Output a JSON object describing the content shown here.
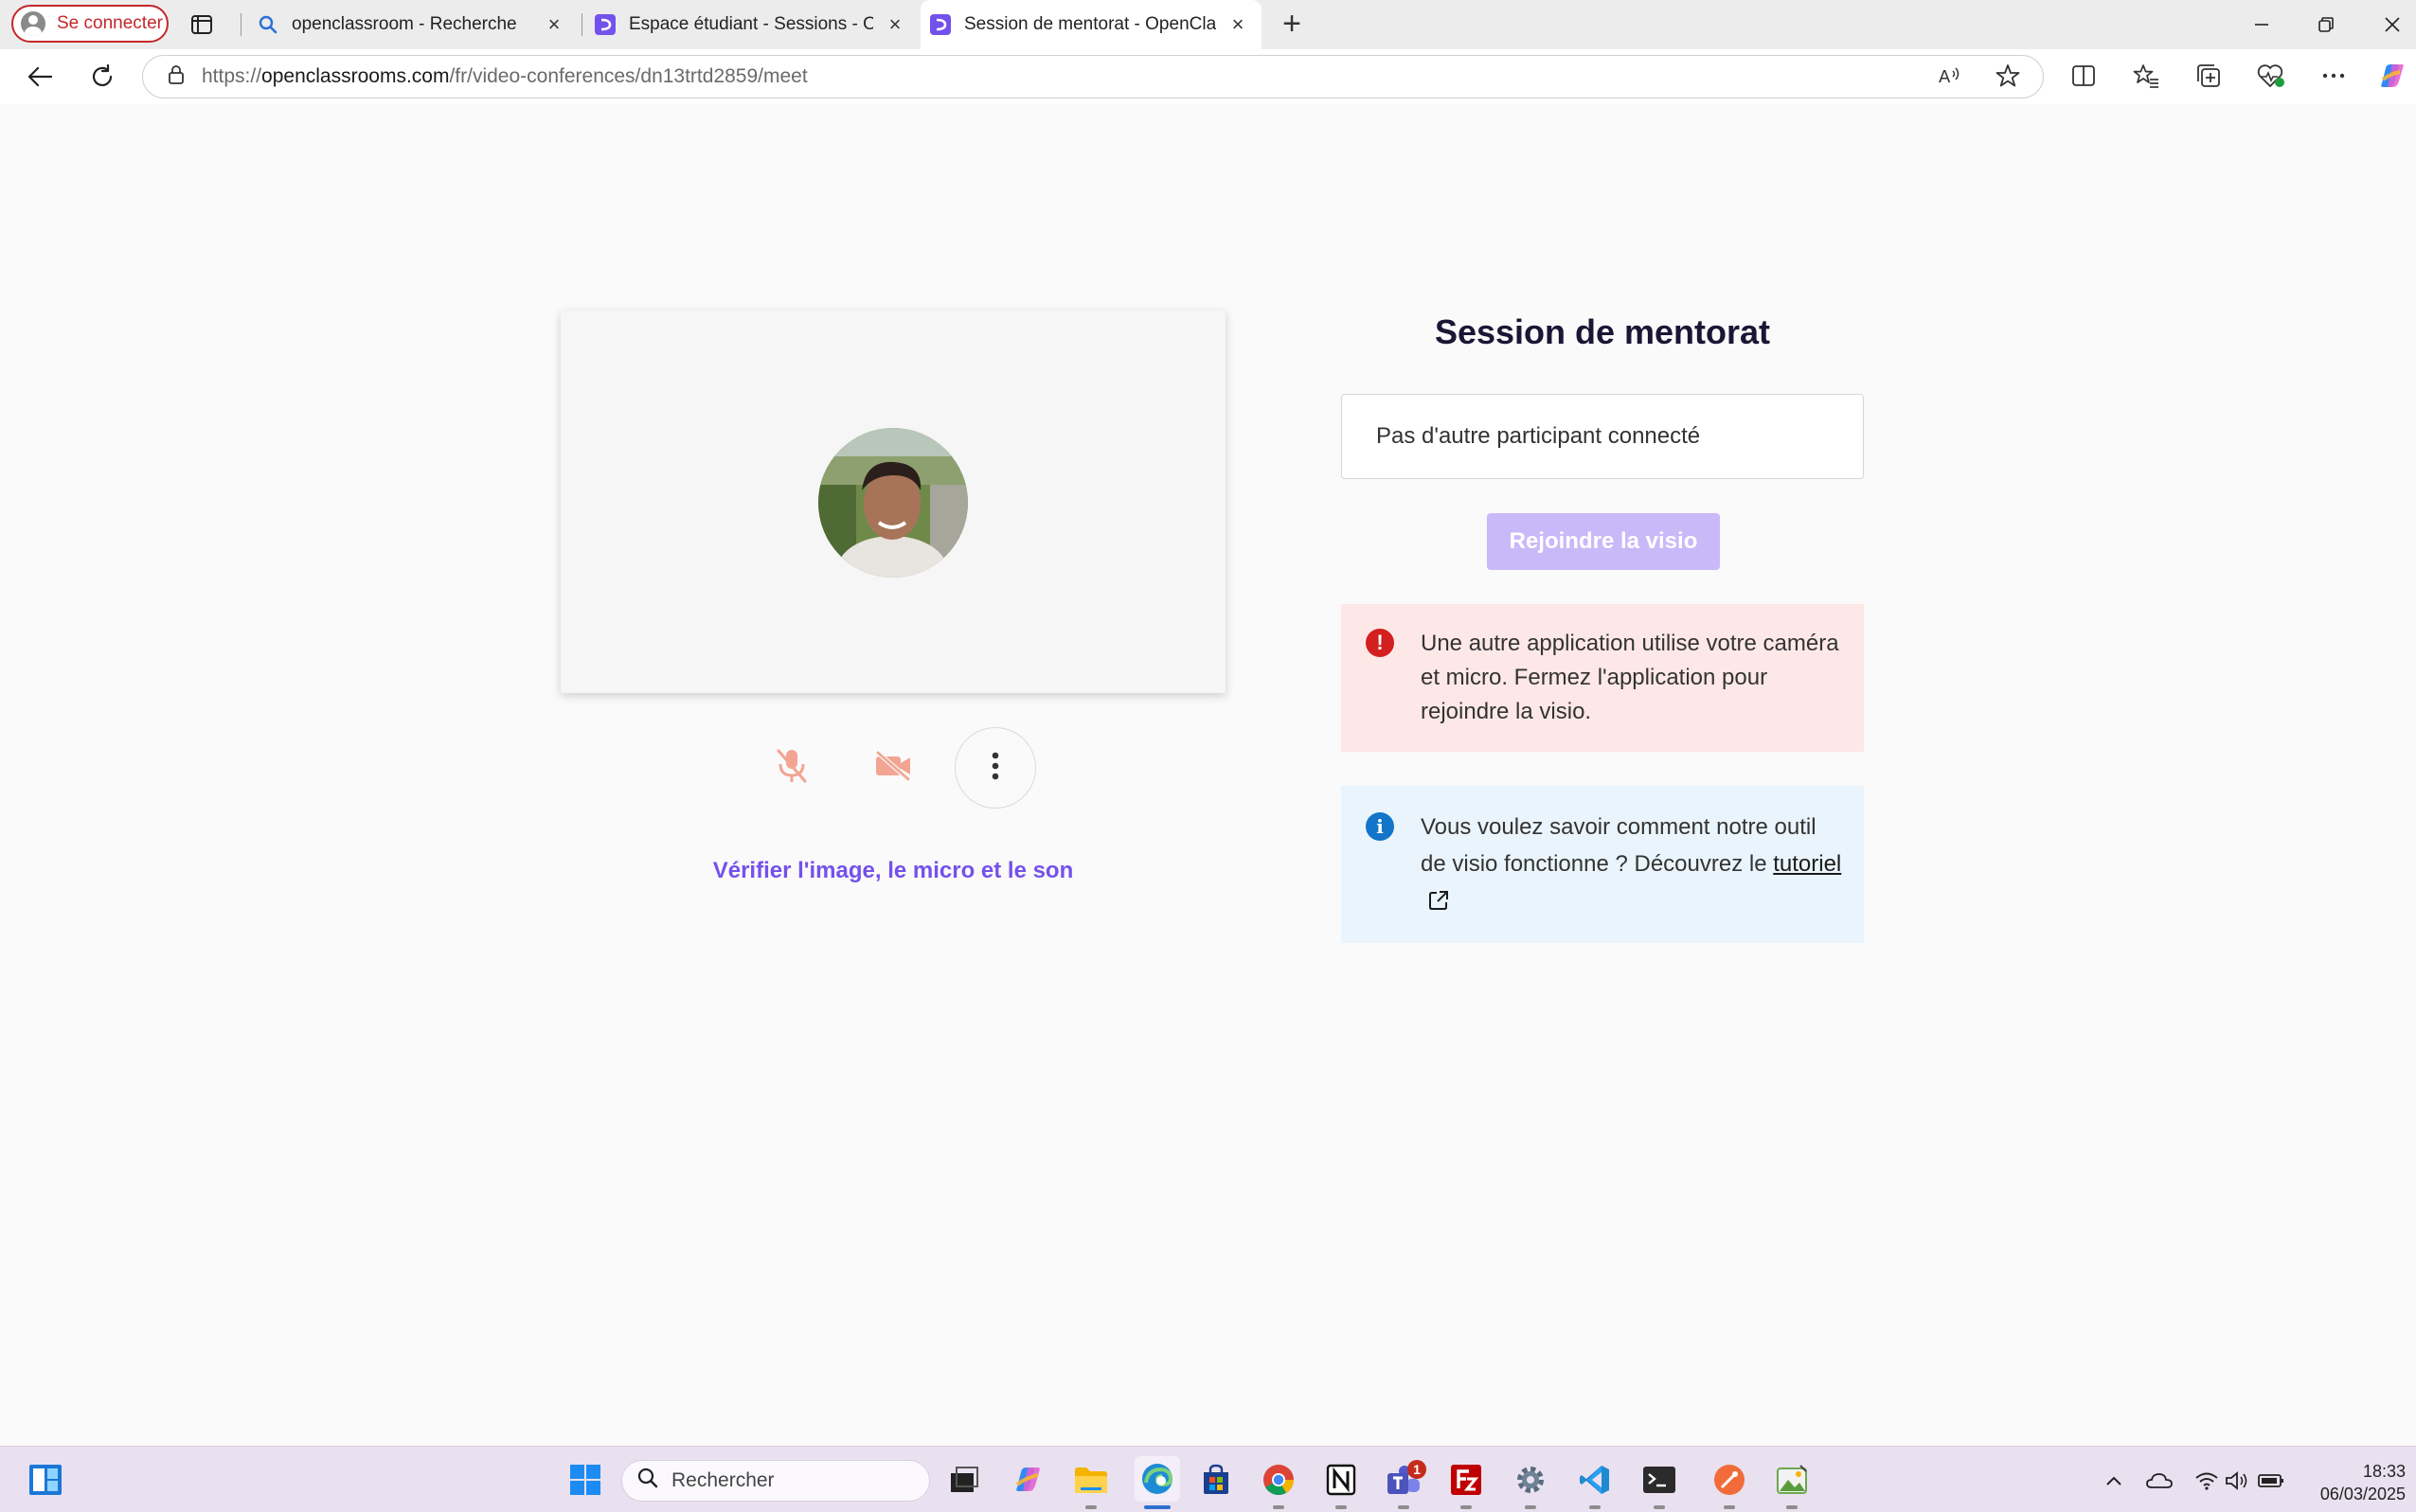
{
  "browser": {
    "profile_label": "Se connecter",
    "tabs": [
      {
        "title": "openclassroom - Recherche",
        "favicon": "search-icon"
      },
      {
        "title": "Espace étudiant - Sessions - Open",
        "favicon": "openclassrooms-icon"
      },
      {
        "title": "Session de mentorat - OpenClassr",
        "favicon": "openclassrooms-icon",
        "active": true
      }
    ],
    "url_scheme": "https://",
    "url_host": "openclassrooms.com",
    "url_path": "/fr/video-conferences/dn13trtd2859/meet"
  },
  "page": {
    "verify_link": "Vérifier l'image, le micro et le son",
    "session_title": "Session de mentorat",
    "participants_text": "Pas d'autre participant connecté",
    "join_button": "Rejoindre la visio",
    "error_alert": "Une autre application utilise votre caméra et micro. Fermez l'application pour rejoindre la visio.",
    "info_alert_text": "Vous voulez savoir comment notre outil de visio fonctionne ? Découvrez le",
    "info_alert_link": "tutoriel",
    "accent_color": "#7451eb",
    "error_color": "#d31f1f",
    "info_color": "#1275c9"
  },
  "taskbar": {
    "search_placeholder": "Rechercher",
    "teams_badge": "1",
    "time": "18:33",
    "date": "06/03/2025"
  }
}
